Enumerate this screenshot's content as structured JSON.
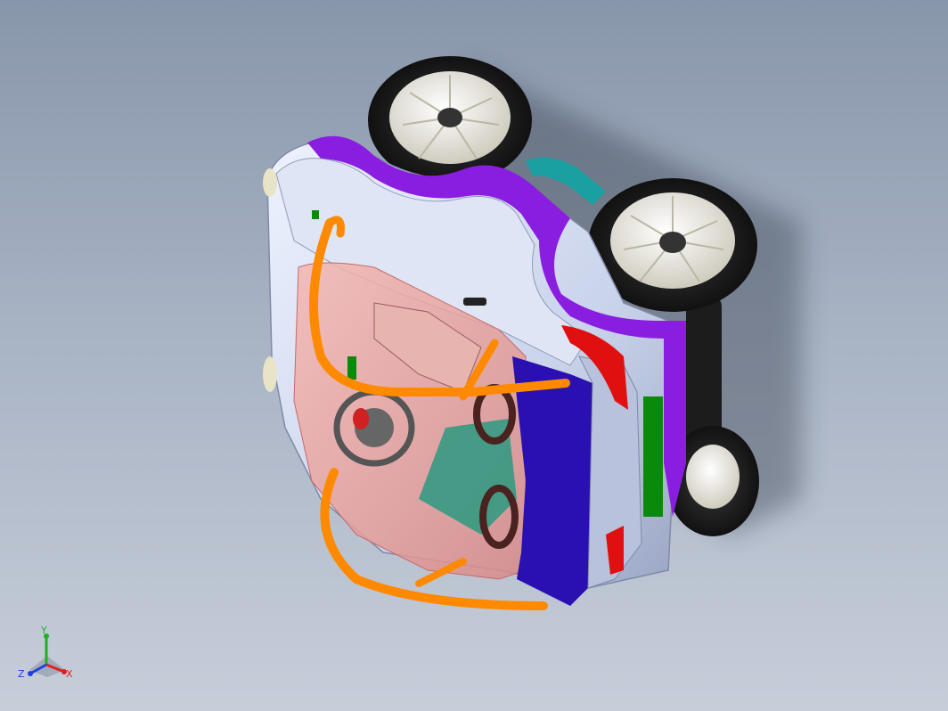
{
  "viewport": {
    "background_top": "#8896ab",
    "background_bottom": "#c7ceda"
  },
  "model": {
    "body_color": "#c9d3ea",
    "trim_color": "#8a1ee0",
    "handle_color": "#ff8a00",
    "glass_color": "#e8a0a0",
    "panel_color": "#2a10b0",
    "light_color": "#e01010",
    "accent_green": "#0a8a0a",
    "axle_color": "#1aa0a0",
    "tire_color": "#2a2a2a",
    "rim_color": "#e8e6da"
  },
  "triad": {
    "x_label": "X",
    "y_label": "Y",
    "z_label": "Z",
    "x_color": "#e02020",
    "y_color": "#20b020",
    "z_color": "#2040e0"
  }
}
